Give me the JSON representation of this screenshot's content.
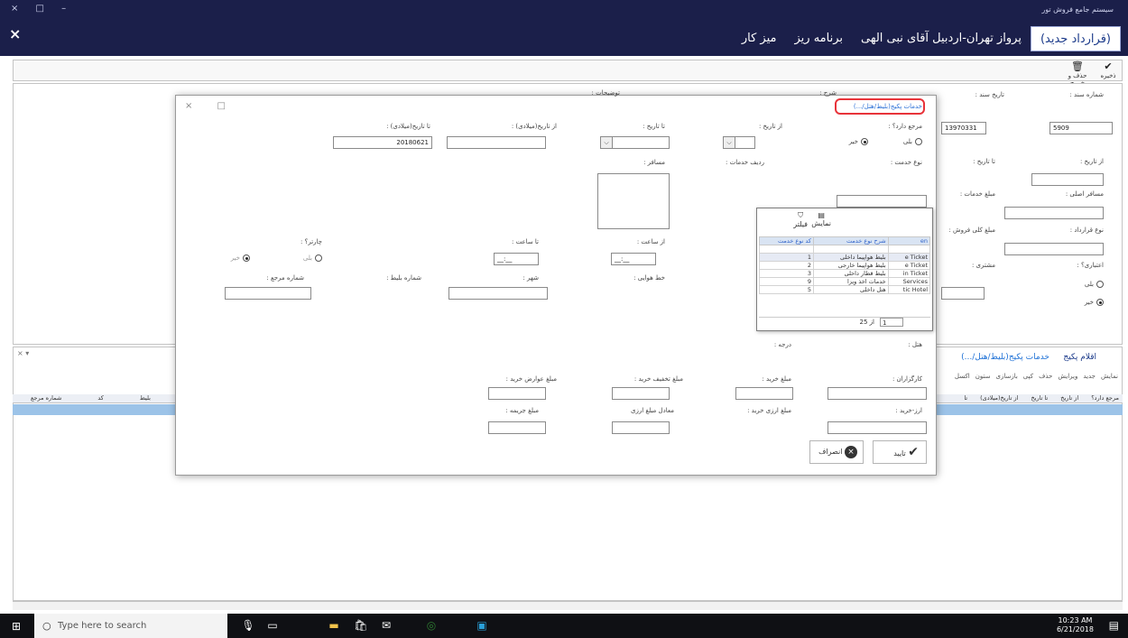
{
  "window": {
    "controls": "×   □   –",
    "app_title": "سیستم جامع فروش تور",
    "close_label": "×"
  },
  "menu": [
    {
      "label": "میز کار",
      "active": false
    },
    {
      "label": "برنامه ریز",
      "active": false
    },
    {
      "label": "پرواز تهران-اردبیل آقای نبی الهی",
      "active": false
    },
    {
      "label": "(قرارداد جدید)",
      "active": true
    }
  ],
  "toolbar": {
    "save_label": "ذخیره",
    "delete_exit_label": "حذف و خروج"
  },
  "main_form": {
    "doc_number_label": "شماره سند :",
    "doc_number_value": "5909",
    "doc_date_label": "تاریخ سند :",
    "doc_date_value": "13970331",
    "from_date_label": "از تاریخ :",
    "to_date_label": "تا تاریخ :",
    "main_traveler_label": "مسافر اصلی :",
    "service_amount_label": "مبلغ خدمات :",
    "contract_type_label": "نوع قرارداد :",
    "total_sale_label": "مبلغ کلی فروش :",
    "credit_label": "اعتباری؟ :",
    "yes_label": "بلی",
    "no_label": "خیر",
    "customer_label": "مشتری :"
  },
  "detail": {
    "tab_package": "اقلام پکیج",
    "tab_services": "خدمات پکیج(بلیط/هتل/...)",
    "grid_cols": [
      "مرجع دارد؟",
      "از تاریخ",
      "تا تاریخ",
      "از تاریخ(میلادی)",
      "تا"
    ],
    "left_cols": [
      "شماره مرجع",
      "کد",
      "بلیط"
    ],
    "actions": [
      "نمایش",
      "جدید",
      "ویرایش",
      "حذف",
      "کپی",
      "بازسازی",
      "ستون",
      "اکسل"
    ]
  },
  "dialog": {
    "subtitle": "خدمات پکیج(بلیط/هتل/...)",
    "description_label": "شرح :",
    "notes_label": "توضیحات :",
    "has_ref_label": "مرجع دارد؟ :",
    "yes_label": "بلی",
    "no_label": "خیر",
    "from_date_label": "از تاریخ :",
    "to_date_label": "تا تاریخ :",
    "from_date_g_label": "از تاریخ(میلادی) :",
    "to_date_g_label": "تا تاریخ(میلادی) :",
    "to_date_g_value": "20180621",
    "service_type_label": "نوع خدمت :",
    "service_row_label": "ردیف خدمات :",
    "traveler_label": "مسافر :",
    "from_time_label": "از ساعت :",
    "to_time_label": "تا ساعت :",
    "time_placeholder": "__:__",
    "charter_label": "چارتر؟ :",
    "airline_label": "خط هوایی :",
    "city_label": "شهر :",
    "ticket_no_label": "شماره بلیط :",
    "ref_no_label": "شماره مرجع :",
    "hotel_label": "هتل :",
    "grade_label": "درجه :",
    "agents_label": "کارگزاران :",
    "buy_amount_label": "مبلغ خرید :",
    "buy_discount_label": "مبلغ تخفیف خرید :",
    "buy_fees_label": "مبلغ عوارض خرید :",
    "currency_label": "ارز-خرید :",
    "currency_buy_label": "مبلغ ارزی خرید :",
    "currency_equiv_label": "معادل مبلغ ارزی",
    "penalty_label": "مبلغ جریمه :",
    "ok_label": "تایید",
    "cancel_label": "انصراف"
  },
  "popup": {
    "show_label": "نمایش",
    "filter_label": "فیلتر",
    "columns": [
      "کد نوع خدمت",
      "شرح نوع خدمت",
      "en"
    ],
    "rows": [
      {
        "code": "1",
        "title": "بلیط هواپیما داخلی",
        "en": "e Ticket"
      },
      {
        "code": "2",
        "title": "بلیط هواپیما خارجی",
        "en": "e Ticket"
      },
      {
        "code": "3",
        "title": "بلیط قطار داخلی",
        "en": "in Ticket"
      },
      {
        "code": "9",
        "title": "خدمات اخذ ویزا",
        "en": "Services"
      },
      {
        "code": "5",
        "title": "هتل داخلی",
        "en": "tic Hotel"
      }
    ],
    "pager_current": "1",
    "pager_of": "از 25"
  },
  "taskbar": {
    "search_placeholder": "Type here to search",
    "time": "10:23 AM",
    "date": "6/21/2018"
  }
}
